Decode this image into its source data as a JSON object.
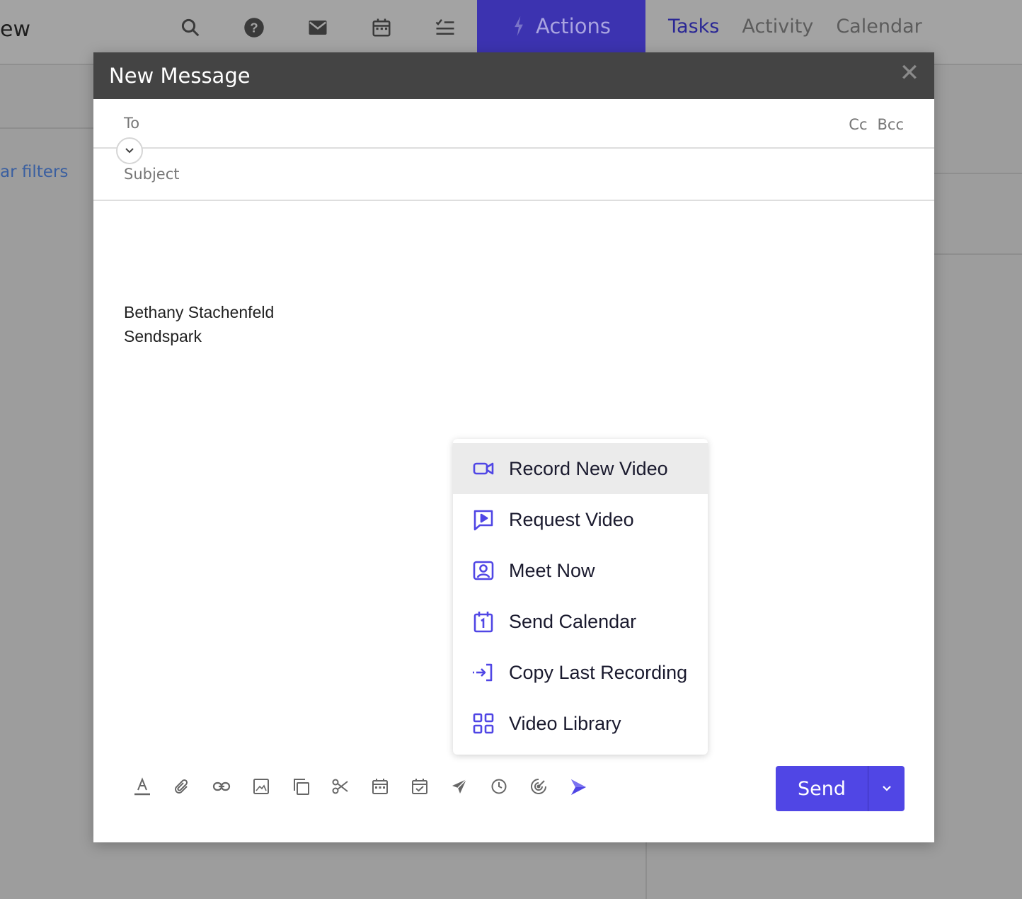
{
  "background": {
    "title_partial": "ew",
    "actions_label": "Actions",
    "tabs": [
      {
        "label": "Tasks",
        "active": true
      },
      {
        "label": "Activity",
        "active": false
      },
      {
        "label": "Calendar",
        "active": false
      }
    ],
    "filters_link": "ar filters",
    "nav_icons": [
      "search-icon",
      "help-icon",
      "mail-icon",
      "calendar-icon",
      "checklist-icon"
    ]
  },
  "modal": {
    "title": "New Message",
    "close_glyph": "✕",
    "to_label": "To",
    "cc_label": "Cc",
    "bcc_label": "Bcc",
    "subject_label": "Subject",
    "signature": {
      "name": "Bethany Stachenfeld",
      "company": "Sendspark"
    }
  },
  "menu": {
    "items": [
      {
        "label": "Record New Video",
        "icon": "video-camera-icon",
        "hovered": true
      },
      {
        "label": "Request Video",
        "icon": "request-video-icon",
        "hovered": false
      },
      {
        "label": "Meet Now",
        "icon": "meet-now-icon",
        "hovered": false
      },
      {
        "label": "Send Calendar",
        "icon": "send-calendar-icon",
        "hovered": false
      },
      {
        "label": "Copy Last Recording",
        "icon": "copy-recording-icon",
        "hovered": false
      },
      {
        "label": "Video Library",
        "icon": "video-library-icon",
        "hovered": false
      }
    ],
    "accent_color": "#5046e5"
  },
  "toolbar": {
    "icons": [
      "text-format-icon",
      "attachment-icon",
      "link-icon",
      "image-icon",
      "template-icon",
      "snippet-icon",
      "calendar-icon",
      "task-icon",
      "send-later-icon",
      "reminder-icon",
      "tracking-icon",
      "sendspark-icon"
    ]
  },
  "send": {
    "label": "Send",
    "color": "#5046e5"
  }
}
